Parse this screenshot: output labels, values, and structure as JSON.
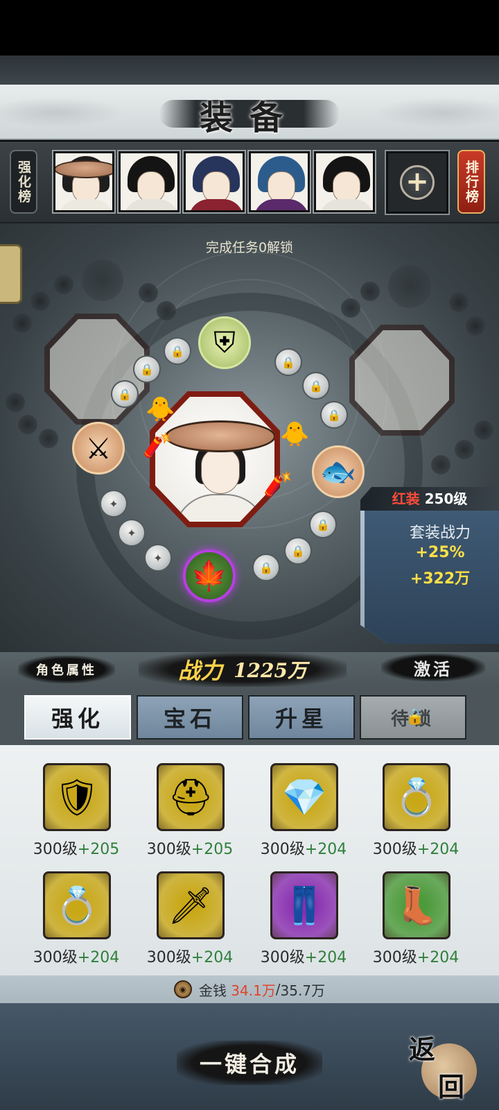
{
  "header": {
    "title": "装备"
  },
  "rank_left": {
    "label": "强化榜"
  },
  "rank_right": {
    "label": "排行榜"
  },
  "heroes": [
    {
      "name": "hero-portrait-1",
      "hair": "#1e1e1e",
      "robe": "#ece9e0",
      "hat": true
    },
    {
      "name": "hero-portrait-2",
      "hair": "#141414",
      "robe": "#e6e3dc",
      "hat": false
    },
    {
      "name": "hero-portrait-3",
      "hair": "#27345c",
      "robe": "#8a2230",
      "hat": false
    },
    {
      "name": "hero-portrait-4",
      "hair": "#2c5c8c",
      "robe": "#5a2a6a",
      "hat": false
    },
    {
      "name": "hero-portrait-5",
      "hair": "#141414",
      "robe": "#e6e3dc",
      "hat": false
    }
  ],
  "add_slot": {
    "icon": "+"
  },
  "arena": {
    "unlock_hint": "完成任务0解锁"
  },
  "set_bonus": {
    "header_prefix": "红装",
    "level": "250",
    "header_suffix": "级",
    "label": "套装战力",
    "percent": "+25%",
    "value": "+322万"
  },
  "power": {
    "attr_button": "角色属性",
    "label": "战力",
    "value": "1225万",
    "activate_button": "激活"
  },
  "tabs": [
    {
      "label": "强化",
      "state": "active"
    },
    {
      "label": "宝石",
      "state": "normal"
    },
    {
      "label": "升星",
      "state": "normal"
    },
    {
      "label": "待锁",
      "state": "locked"
    }
  ],
  "equipment": [
    {
      "level": "300级",
      "bonus": "+205",
      "icon": "shoulder-armor",
      "bg": "#c9a818"
    },
    {
      "level": "300级",
      "bonus": "+205",
      "icon": "helmet",
      "bg": "#c9a818"
    },
    {
      "level": "300级",
      "bonus": "+204",
      "icon": "amulet",
      "bg": "#c9a818"
    },
    {
      "level": "300级",
      "bonus": "+204",
      "icon": "ring",
      "bg": "#c9a818"
    },
    {
      "level": "300级",
      "bonus": "+204",
      "icon": "ring",
      "bg": "#c9a818"
    },
    {
      "level": "300级",
      "bonus": "+204",
      "icon": "bracer",
      "bg": "#c9a818"
    },
    {
      "level": "300级",
      "bonus": "+204",
      "icon": "leg-armor",
      "bg": "#8a2fb0"
    },
    {
      "level": "300级",
      "bonus": "+204",
      "icon": "boots",
      "bg": "#4c9a3a"
    }
  ],
  "money": {
    "label": "金钱",
    "current": "34.1万",
    "separator": "/",
    "max": "35.7万"
  },
  "bottom": {
    "combine_button": "一键合成",
    "back_top": "返",
    "back_bottom": "回"
  },
  "colors": {
    "accent_gold": "#ffd24a",
    "bonus_green": "#2f7f3c",
    "money_red": "#e0432c",
    "set_red": "#ff4b3a"
  }
}
